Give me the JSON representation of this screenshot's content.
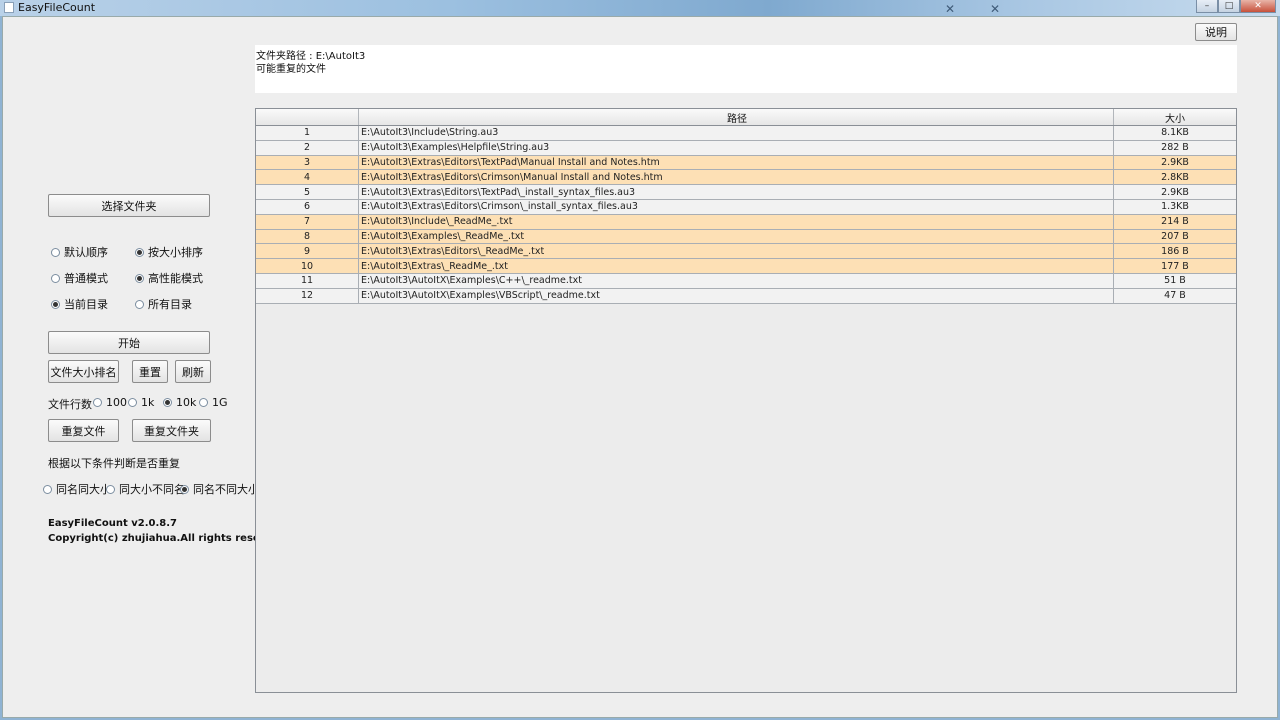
{
  "window": {
    "title": "EasyFileCount"
  },
  "help_button": "说明",
  "info": {
    "folder_path": "文件夹路径 : E:\\AutoIt3",
    "subtitle": "可能重复的文件"
  },
  "left": {
    "select_folder": "选择文件夹",
    "sort_options": [
      {
        "label": "默认顺序",
        "checked": false
      },
      {
        "label": "按大小排序",
        "checked": true
      }
    ],
    "mode_options": [
      {
        "label": "普通模式",
        "checked": false
      },
      {
        "label": "高性能模式",
        "checked": true
      }
    ],
    "scope_options": [
      {
        "label": "当前目录",
        "checked": true
      },
      {
        "label": "所有目录",
        "checked": false
      }
    ],
    "start": "开始",
    "size_rank": "文件大小排名",
    "reset": "重置",
    "refresh": "刷新",
    "line_count_label": "文件行数",
    "line_options": [
      {
        "label": "100",
        "checked": false
      },
      {
        "label": "1k",
        "checked": false
      },
      {
        "label": "10k",
        "checked": true
      },
      {
        "label": "1G",
        "checked": false
      }
    ],
    "dup_files": "重复文件",
    "dup_folders": "重复文件夹",
    "criteria_label": "根据以下条件判断是否重复",
    "criteria_options": [
      {
        "label": "同名同大小",
        "checked": false
      },
      {
        "label": "同大小不同名",
        "checked": false
      },
      {
        "label": "同名不同大小",
        "checked": true
      }
    ],
    "version": "EasyFileCount v2.0.8.7",
    "copyright": "Copyright(c) zhujiahua.All rights reserved."
  },
  "table": {
    "headers": [
      "",
      "路径",
      "大小"
    ],
    "rows": [
      {
        "n": "1",
        "path": "E:\\AutoIt3\\Include\\String.au3",
        "size": "8.1KB",
        "hl": false
      },
      {
        "n": "2",
        "path": "E:\\AutoIt3\\Examples\\Helpfile\\String.au3",
        "size": "282 B",
        "hl": false
      },
      {
        "n": "3",
        "path": "E:\\AutoIt3\\Extras\\Editors\\TextPad\\Manual Install and Notes.htm",
        "size": "2.9KB",
        "hl": true
      },
      {
        "n": "4",
        "path": "E:\\AutoIt3\\Extras\\Editors\\Crimson\\Manual Install and Notes.htm",
        "size": "2.8KB",
        "hl": true
      },
      {
        "n": "5",
        "path": "E:\\AutoIt3\\Extras\\Editors\\TextPad\\_install_syntax_files.au3",
        "size": "2.9KB",
        "hl": false
      },
      {
        "n": "6",
        "path": "E:\\AutoIt3\\Extras\\Editors\\Crimson\\_install_syntax_files.au3",
        "size": "1.3KB",
        "hl": false
      },
      {
        "n": "7",
        "path": "E:\\AutoIt3\\Include\\_ReadMe_.txt",
        "size": "214 B",
        "hl": true
      },
      {
        "n": "8",
        "path": "E:\\AutoIt3\\Examples\\_ReadMe_.txt",
        "size": "207 B",
        "hl": true
      },
      {
        "n": "9",
        "path": "E:\\AutoIt3\\Extras\\Editors\\_ReadMe_.txt",
        "size": "186 B",
        "hl": true
      },
      {
        "n": "10",
        "path": "E:\\AutoIt3\\Extras\\_ReadMe_.txt",
        "size": "177 B",
        "hl": true
      },
      {
        "n": "11",
        "path": "E:\\AutoIt3\\AutoItX\\Examples\\C++\\_readme.txt",
        "size": "51 B",
        "hl": false
      },
      {
        "n": "12",
        "path": "E:\\AutoIt3\\AutoItX\\Examples\\VBScript\\_readme.txt",
        "size": "47 B",
        "hl": false
      }
    ]
  }
}
